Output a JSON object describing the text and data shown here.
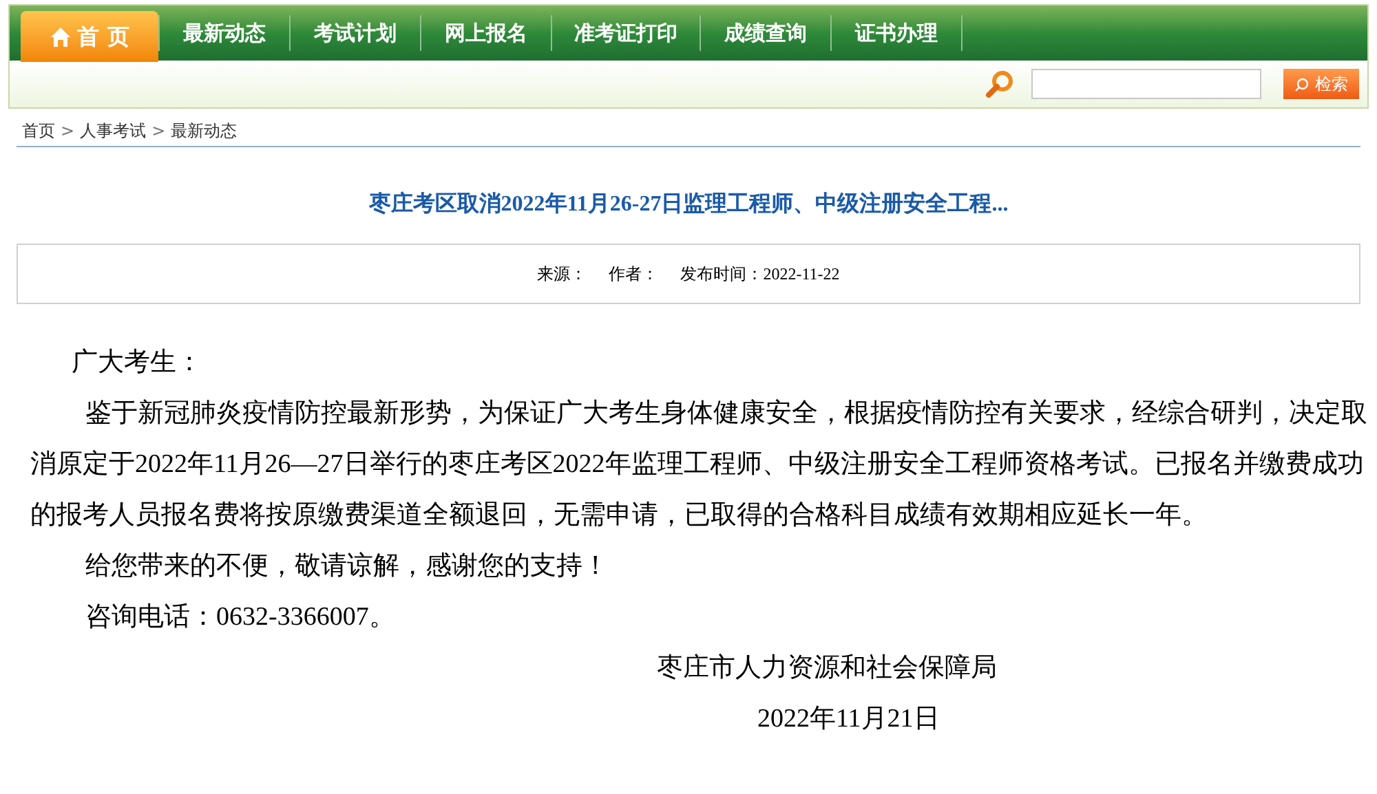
{
  "nav": [
    {
      "label": "首 页",
      "selected": true,
      "kind": "home"
    },
    {
      "label": "最新动态",
      "selected": false,
      "kind": "link"
    },
    {
      "label": "考试计划",
      "selected": false,
      "kind": "link"
    },
    {
      "label": "网上报名",
      "selected": false,
      "kind": "link"
    },
    {
      "label": "准考证打印",
      "selected": false,
      "kind": "link"
    },
    {
      "label": "成绩查询",
      "selected": false,
      "kind": "link"
    },
    {
      "label": "证书办理",
      "selected": false,
      "kind": "link"
    }
  ],
  "search": {
    "button": "检索"
  },
  "breadcrumb": [
    "首页",
    "人事考试",
    "最新动态"
  ],
  "breadcrumb_separator": ">",
  "article": {
    "title": "枣庄考区取消2022年11月26-27日监理工程师、中级注册安全工程...",
    "meta": [
      "来源：",
      "作者：",
      "发布时间：2022-11-22"
    ],
    "greeting": "广大考生：",
    "paragraphs": [
      "鉴于新冠肺炎疫情防控最新形势，为保证广大考生身体健康安全，根据疫情防控有关要求，经综合研判，决定取消原定于2022年11月26—27日举行的枣庄考区2022年监理工程师、中级注册安全工程师资格考试。已报名并缴费成功的报考人员报名费将按原缴费渠道全额退回，无需申请，已取得的合格科目成绩有效期相应延长一年。",
      "给您带来的不便，敬请谅解，感谢您的支持！",
      "咨询电话：0632-3366007。"
    ],
    "signature": "枣庄市人力资源和社会保障局",
    "date": "2022年11月21日"
  }
}
